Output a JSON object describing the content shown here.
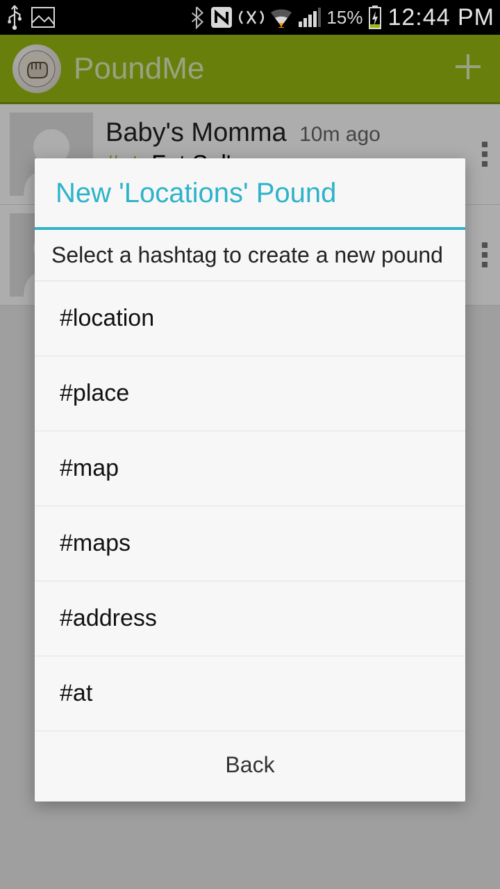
{
  "status": {
    "battery_pct": "15%",
    "time": "12:44 PM"
  },
  "actionbar": {
    "app_title": "PoundMe"
  },
  "feed": {
    "items": [
      {
        "name": "Baby's Momma",
        "time": "10m ago",
        "hash_label": "#at:",
        "hash_value": " Fat Sal's"
      }
    ]
  },
  "dialog": {
    "title": "New 'Locations' Pound",
    "prompt": "Select a hashtag to create a new pound",
    "options": [
      "#location",
      "#place",
      "#map",
      "#maps",
      "#address",
      "#at"
    ],
    "back_label": "Back"
  }
}
